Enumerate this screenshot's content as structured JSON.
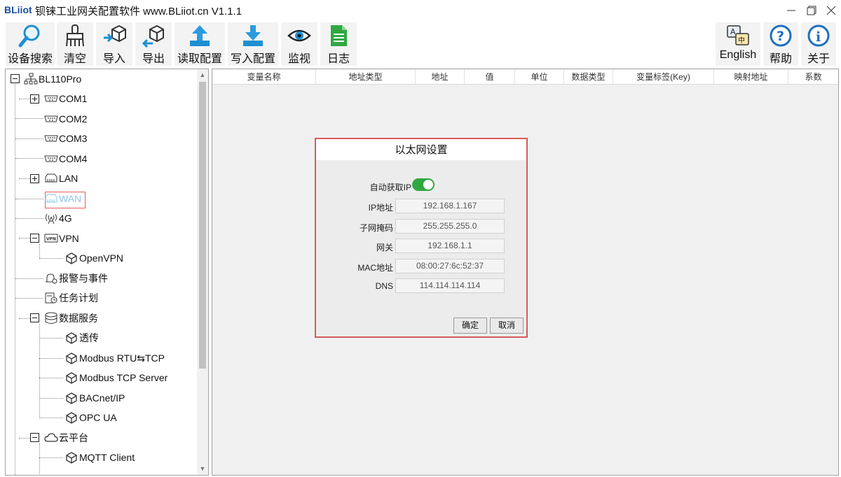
{
  "titlebar": {
    "brand": "BLiiot",
    "title": "钡铼工业网关配置软件 www.BLiiot.cn V1.1.1"
  },
  "toolbar": {
    "left": [
      {
        "label": "设备搜索",
        "icon": "magnifier-icon"
      },
      {
        "label": "清空",
        "icon": "broom-icon"
      },
      {
        "label": "导入",
        "icon": "import-box-icon"
      },
      {
        "label": "导出",
        "icon": "export-box-icon"
      },
      {
        "label": "读取配置",
        "icon": "upload-arrow-icon"
      },
      {
        "label": "写入配置",
        "icon": "download-arrow-icon"
      },
      {
        "label": "监视",
        "icon": "eye-icon"
      },
      {
        "label": "日志",
        "icon": "document-icon"
      }
    ],
    "right": [
      {
        "label": "English",
        "icon": "language-icon"
      },
      {
        "label": "帮助",
        "icon": "help-icon"
      },
      {
        "label": "关于",
        "icon": "info-icon"
      }
    ]
  },
  "tree": {
    "root": "BL110Pro",
    "items": [
      {
        "label": "COM1"
      },
      {
        "label": "COM2"
      },
      {
        "label": "COM3"
      },
      {
        "label": "COM4"
      },
      {
        "label": "LAN"
      },
      {
        "label": "WAN"
      },
      {
        "label": "4G"
      },
      {
        "label": "VPN"
      },
      {
        "label": "OpenVPN"
      },
      {
        "label": "报警与事件"
      },
      {
        "label": "任务计划"
      },
      {
        "label": "数据服务"
      },
      {
        "label": "透传"
      },
      {
        "label": "Modbus RTU⇆TCP"
      },
      {
        "label": "Modbus TCP Server"
      },
      {
        "label": "BACnet/IP"
      },
      {
        "label": "OPC UA"
      },
      {
        "label": "云平台"
      },
      {
        "label": "MQTT Client"
      }
    ]
  },
  "table": {
    "columns": [
      "变量名称",
      "地址类型",
      "地址",
      "值",
      "单位",
      "数据类型",
      "变量标签(Key)",
      "映射地址",
      "系数"
    ]
  },
  "dialog": {
    "title": "以太网设置",
    "auto_ip_label": "自动获取IP",
    "auto_ip_on": true,
    "fields": [
      {
        "label": "IP地址",
        "value": "192.168.1.167"
      },
      {
        "label": "子网掩码",
        "value": "255.255.255.0"
      },
      {
        "label": "网关",
        "value": "192.168.1.1"
      },
      {
        "label": "MAC地址",
        "value": "08:00:27:6c:52:37"
      },
      {
        "label": "DNS",
        "value": "114.114.114.114"
      }
    ],
    "ok": "确定",
    "cancel": "取消"
  },
  "colors": {
    "accent": "#1a4f9c",
    "toggle_on": "#2fa842",
    "selected_box": "#e06060",
    "selected_text": "#8ac6ea"
  }
}
